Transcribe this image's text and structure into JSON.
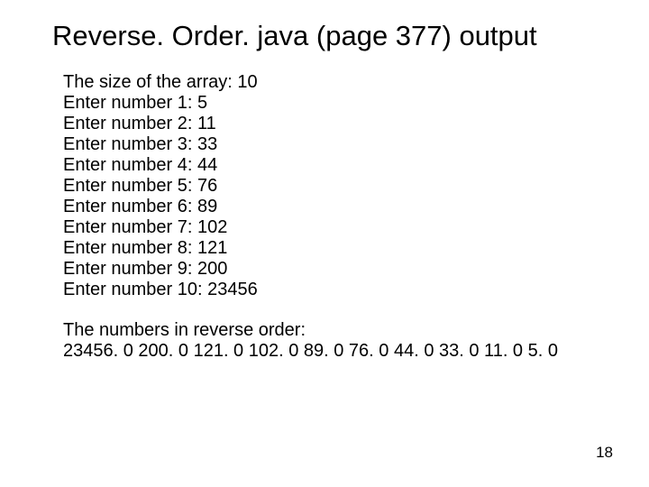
{
  "title": "Reverse. Order. java (page 377) output",
  "size_line": "The size of the array: 10",
  "entries": [
    "Enter number 1: 5",
    "Enter number 2: 11",
    "Enter number 3: 33",
    "Enter number 4: 44",
    "Enter number 5: 76",
    "Enter number 6: 89",
    "Enter number 7: 102",
    "Enter number 8: 121",
    "Enter number 9: 200",
    "Enter number 10: 23456"
  ],
  "reverse_label": "The numbers in reverse order:",
  "reverse_numbers": "23456. 0  200. 0  121. 0  102. 0  89. 0  76. 0  44. 0  33. 0  11. 0  5. 0",
  "page_number": "18"
}
